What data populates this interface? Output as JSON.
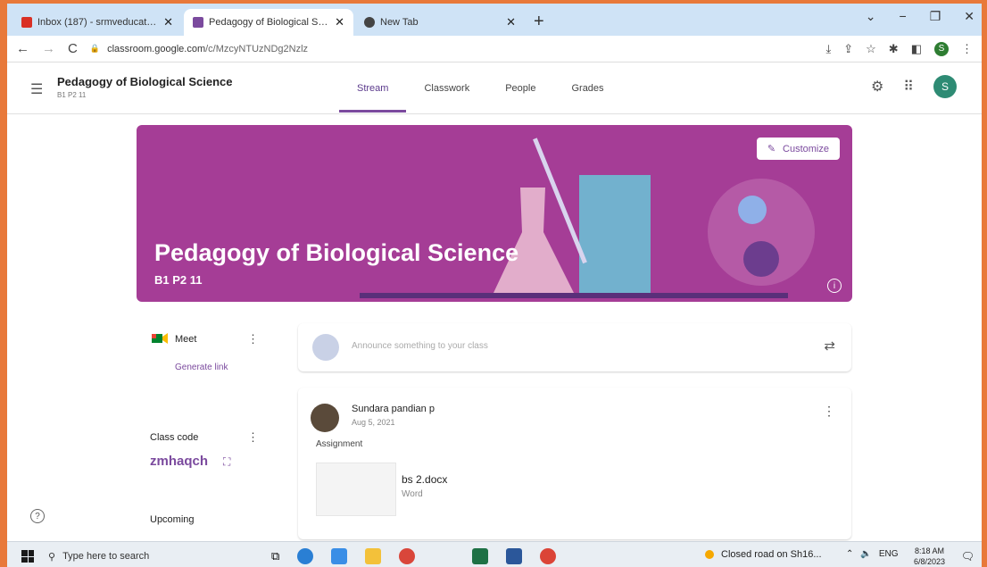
{
  "browser": {
    "tabs": [
      {
        "label": "Inbox (187) - srmveducation@...",
        "favicon_color": "#d93025",
        "active": false
      },
      {
        "label": "Pedagogy of Biological Science",
        "favicon_color": "#7b4a9e",
        "active": true
      },
      {
        "label": "New Tab",
        "favicon_color": "#444444",
        "active": false
      }
    ],
    "new_tab_icon": "plus-icon",
    "url_host": "classroom.google.com",
    "url_path": "/c/MzcyNTUzNDg2Nzlz",
    "profile_initial": "S"
  },
  "header": {
    "class_title": "Pedagogy of Biological Science",
    "class_section": "B1 P2 11",
    "tabs": [
      "Stream",
      "Classwork",
      "People",
      "Grades"
    ],
    "active_tab": "Stream",
    "avatar_initial": "S"
  },
  "banner": {
    "title": "Pedagogy of Biological Science",
    "subtitle": "B1 P2 11",
    "customize_label": "Customize",
    "background_color": "#a53d96"
  },
  "meet": {
    "label": "Meet",
    "generate_link": "Generate link"
  },
  "class_code": {
    "label": "Class code",
    "value": "zmhaqch"
  },
  "upcoming": {
    "label": "Upcoming"
  },
  "announce": {
    "placeholder": "Announce something to your class"
  },
  "post": {
    "author": "Sundara pandian p",
    "date": "Aug 5, 2021",
    "type": "Assignment",
    "attachment_name": "bs 2.docx",
    "attachment_type": "Word"
  },
  "taskbar": {
    "search_placeholder": "Type here to search",
    "news": "Closed road on Sh16...",
    "language": "ENG",
    "time": "8:18 AM",
    "date": "6/8/2023"
  },
  "colors": {
    "accent": "#7b4a9e",
    "banner": "#a53d96"
  }
}
